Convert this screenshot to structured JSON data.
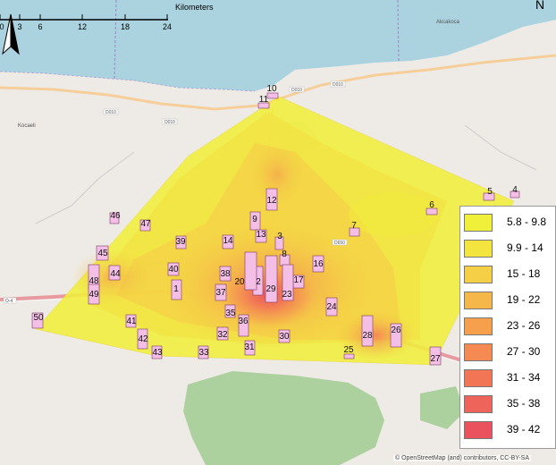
{
  "north_label": "N",
  "map_labels": {
    "town_left": "Kocaeli",
    "town_top_right": "Akcakoca",
    "road_d010_a": "D010",
    "road_d010_b": "D010",
    "road_d010_c": "D010",
    "road_d010_d": "D010",
    "road_d650": "D650",
    "road_o4": "O-4"
  },
  "legend": {
    "items": [
      {
        "label": "5.8 - 9.8",
        "color": "#f0f03a"
      },
      {
        "label": "9.9 - 14",
        "color": "#f3e43e"
      },
      {
        "label": "15 - 18",
        "color": "#f5cf45"
      },
      {
        "label": "19 - 22",
        "color": "#f6b74a"
      },
      {
        "label": "23 - 26",
        "color": "#f6a04e"
      },
      {
        "label": "27 - 30",
        "color": "#f58a52"
      },
      {
        "label": "31 - 34",
        "color": "#f27656"
      },
      {
        "label": "35 - 38",
        "color": "#ee635a"
      },
      {
        "label": "39 - 42",
        "color": "#ea525e"
      }
    ]
  },
  "scale": {
    "ticks": [
      "0",
      "3",
      "6",
      "12",
      "18",
      "24"
    ],
    "unit": "Kilometers"
  },
  "attribution": "© OpenStreetMap (and) contributors, CC-BY-SA",
  "stations": [
    {
      "id": "1"
    },
    {
      "id": "2"
    },
    {
      "id": "3"
    },
    {
      "id": "4"
    },
    {
      "id": "5"
    },
    {
      "id": "6"
    },
    {
      "id": "7"
    },
    {
      "id": "8"
    },
    {
      "id": "9"
    },
    {
      "id": "10"
    },
    {
      "id": "11"
    },
    {
      "id": "12"
    },
    {
      "id": "13"
    },
    {
      "id": "14"
    },
    {
      "id": "16"
    },
    {
      "id": "17"
    },
    {
      "id": "20"
    },
    {
      "id": "23"
    },
    {
      "id": "24"
    },
    {
      "id": "25"
    },
    {
      "id": "26"
    },
    {
      "id": "27"
    },
    {
      "id": "28"
    },
    {
      "id": "29"
    },
    {
      "id": "30"
    },
    {
      "id": "31"
    },
    {
      "id": "32"
    },
    {
      "id": "33"
    },
    {
      "id": "35"
    },
    {
      "id": "36"
    },
    {
      "id": "37"
    },
    {
      "id": "38"
    },
    {
      "id": "39"
    },
    {
      "id": "40"
    },
    {
      "id": "41"
    },
    {
      "id": "42"
    },
    {
      "id": "43"
    },
    {
      "id": "44"
    },
    {
      "id": "45"
    },
    {
      "id": "46"
    },
    {
      "id": "47"
    },
    {
      "id": "48"
    },
    {
      "id": "49"
    },
    {
      "id": "50"
    }
  ]
}
